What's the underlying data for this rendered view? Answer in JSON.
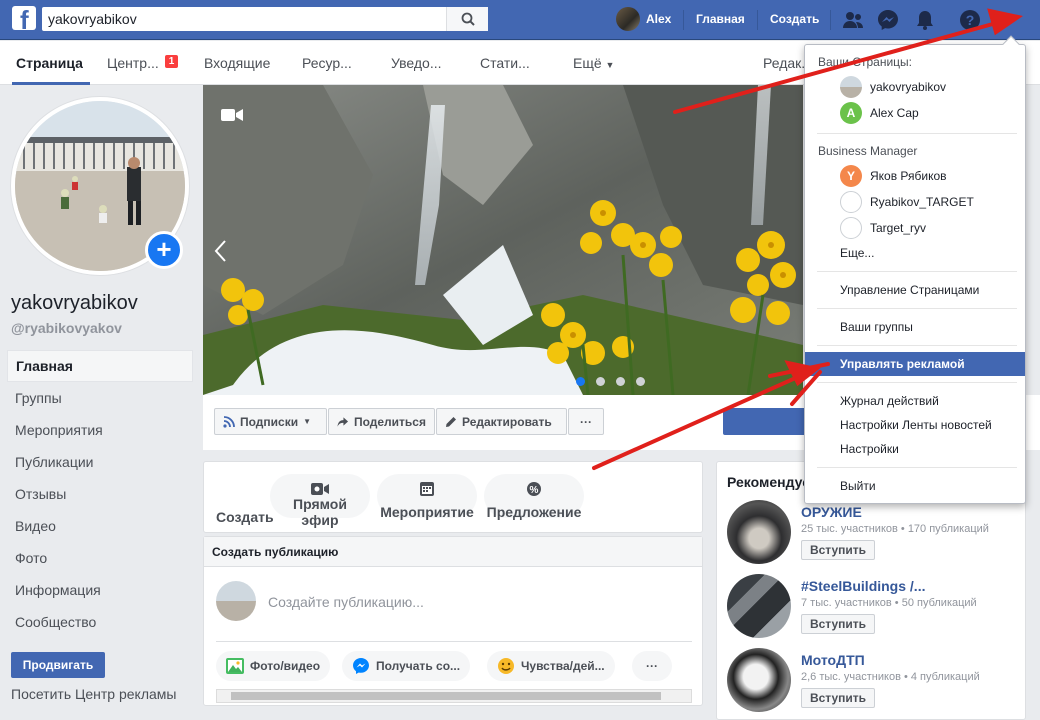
{
  "topbar": {
    "search_value": "yakovryabikov",
    "user_name": "Alex",
    "home_label": "Главная",
    "create_label": "Создать",
    "icons": [
      "friends-icon",
      "messenger-icon",
      "notifications-icon",
      "help-icon",
      "account-menu-icon"
    ]
  },
  "subnav": {
    "tabs": [
      {
        "label": "Страница"
      },
      {
        "label": "Центр..."
      },
      {
        "label": "Входящие"
      },
      {
        "label": "Ресур..."
      },
      {
        "label": "Уведо..."
      },
      {
        "label": "Стати..."
      },
      {
        "label": "Ещё"
      },
      {
        "label": "Редак..."
      }
    ],
    "badge_count": "1"
  },
  "profile": {
    "name": "yakovryabikov",
    "handle": "@ryabikovyakov"
  },
  "left_nav": {
    "items": [
      {
        "label": "Главная"
      },
      {
        "label": "Группы"
      },
      {
        "label": "Мероприятия"
      },
      {
        "label": "Публикации"
      },
      {
        "label": "Отзывы"
      },
      {
        "label": "Видео"
      },
      {
        "label": "Фото"
      },
      {
        "label": "Информация"
      },
      {
        "label": "Сообщество"
      }
    ],
    "promote_label": "Продвигать",
    "ads_center_label": "Посетить Центр рекламы"
  },
  "cover": {
    "slides_count": 4,
    "active_slide": 1
  },
  "actions": {
    "subscriptions": "Подписки",
    "share": "Поделиться",
    "edit": "Редактировать",
    "more": "···"
  },
  "create": {
    "label": "Создать",
    "live_line1": "Прямой",
    "live_line2": "эфир",
    "event": "Мероприятие",
    "offer": "Предложение"
  },
  "post": {
    "header": "Создать публикацию",
    "placeholder": "Создайте публикацию...",
    "photo_video": "Фото/видео",
    "get_messages": "Получать со...",
    "feeling": "Чувства/дей...",
    "more": "···"
  },
  "recommended": {
    "title": "Рекомендуе",
    "join_label": "Вступить",
    "groups": [
      {
        "name": "ОРУЖИЕ",
        "meta": "25 тыс. участников • 170 публикаций"
      },
      {
        "name": "#SteelBuildings /...",
        "meta": "7 тыс. участников • 50 публикаций"
      },
      {
        "name": "МотоДТП",
        "meta": "2,6 тыс. участников • 4 публикаций"
      }
    ]
  },
  "dropdown": {
    "your_pages_header": "Ваши Страницы:",
    "pages": [
      {
        "name": "yakovryabikov"
      },
      {
        "name": "Alex Cap",
        "initial": "A"
      }
    ],
    "bm_header": "Business Manager",
    "bm_items": [
      {
        "name": "Яков Рябиков",
        "initial": "Y"
      },
      {
        "name": "Ryabikov_TARGET"
      },
      {
        "name": "Target_ryv"
      }
    ],
    "more": "Еще...",
    "manage_pages": "Управление Страницами",
    "your_groups": "Ваши группы",
    "manage_ads": "Управлять рекламой",
    "activity_log": "Журнал действий",
    "news_feed_settings": "Настройки Ленты новостей",
    "settings": "Настройки",
    "logout": "Выйти"
  },
  "colors": {
    "brand": "#4267b2",
    "annotation_arrow": "#e0201b"
  }
}
